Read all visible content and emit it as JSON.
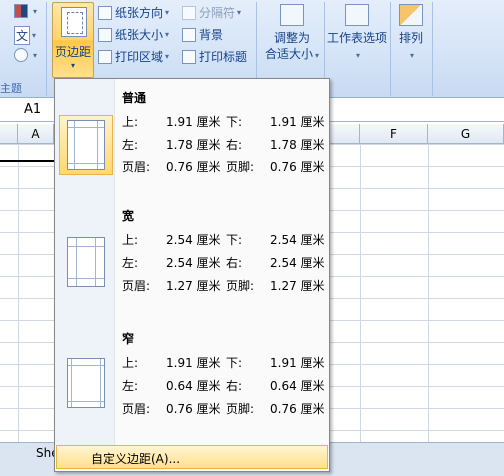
{
  "ribbon": {
    "group_label": "主题",
    "theme_text_label": "文",
    "margins_label": "页边距",
    "orientation_label": "纸张方向",
    "size_label": "纸张大小",
    "print_area_label": "打印区域",
    "breaks_label": "分隔符",
    "background_label": "背景",
    "print_titles_label": "打印标题",
    "scale_to_fit_line1": "调整为",
    "scale_to_fit_line2": "合适大小",
    "sheet_options_label": "工作表选项",
    "arrange_label": "排列"
  },
  "sheet": {
    "name_box": "A1",
    "columns": [
      "A",
      "F",
      "G"
    ],
    "tab_partial": "She"
  },
  "margins_menu": {
    "presets": [
      {
        "name": "普通",
        "top_label": "上:",
        "top": "1.91 厘米",
        "bottom_label": "下:",
        "bottom": "1.91 厘米",
        "left_label": "左:",
        "left": "1.78 厘米",
        "right_label": "右:",
        "right": "1.78 厘米",
        "header_label": "页眉:",
        "header": "0.76 厘米",
        "footer_label": "页脚:",
        "footer": "0.76 厘米"
      },
      {
        "name": "宽",
        "top_label": "上:",
        "top": "2.54 厘米",
        "bottom_label": "下:",
        "bottom": "2.54 厘米",
        "left_label": "左:",
        "left": "2.54 厘米",
        "right_label": "右:",
        "right": "2.54 厘米",
        "header_label": "页眉:",
        "header": "1.27 厘米",
        "footer_label": "页脚:",
        "footer": "1.27 厘米"
      },
      {
        "name": "窄",
        "top_label": "上:",
        "top": "1.91 厘米",
        "bottom_label": "下:",
        "bottom": "1.91 厘米",
        "left_label": "左:",
        "left": "0.64 厘米",
        "right_label": "右:",
        "right": "0.64 厘米",
        "header_label": "页眉:",
        "header": "0.76 厘米",
        "footer_label": "页脚:",
        "footer": "0.76 厘米"
      }
    ],
    "custom_label": "自定义边距(A)..."
  }
}
